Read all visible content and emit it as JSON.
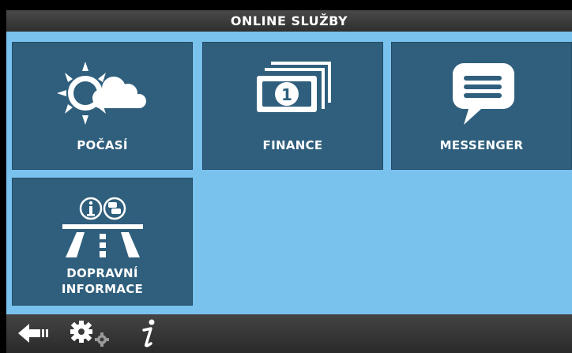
{
  "header": {
    "title": "ONLINE SLUŽBY"
  },
  "tiles": [
    {
      "label": "POČASÍ",
      "icon": "weather-icon"
    },
    {
      "label": "FINANCE",
      "icon": "banknote-icon"
    },
    {
      "label": "MESSENGER",
      "icon": "chat-icon"
    },
    {
      "label_line1": "DOPRAVNÍ",
      "label_line2": "INFORMACE",
      "icon": "traffic-info-icon"
    }
  ],
  "footer": {
    "buttons": [
      {
        "icon": "back-arrow-icon"
      },
      {
        "icon": "settings-gears-icon"
      },
      {
        "icon": "info-icon"
      }
    ]
  },
  "colors": {
    "background": "#79c2ee",
    "tile": "#2f5f7d",
    "bar": "#3a3a3a",
    "text": "#ffffff"
  }
}
